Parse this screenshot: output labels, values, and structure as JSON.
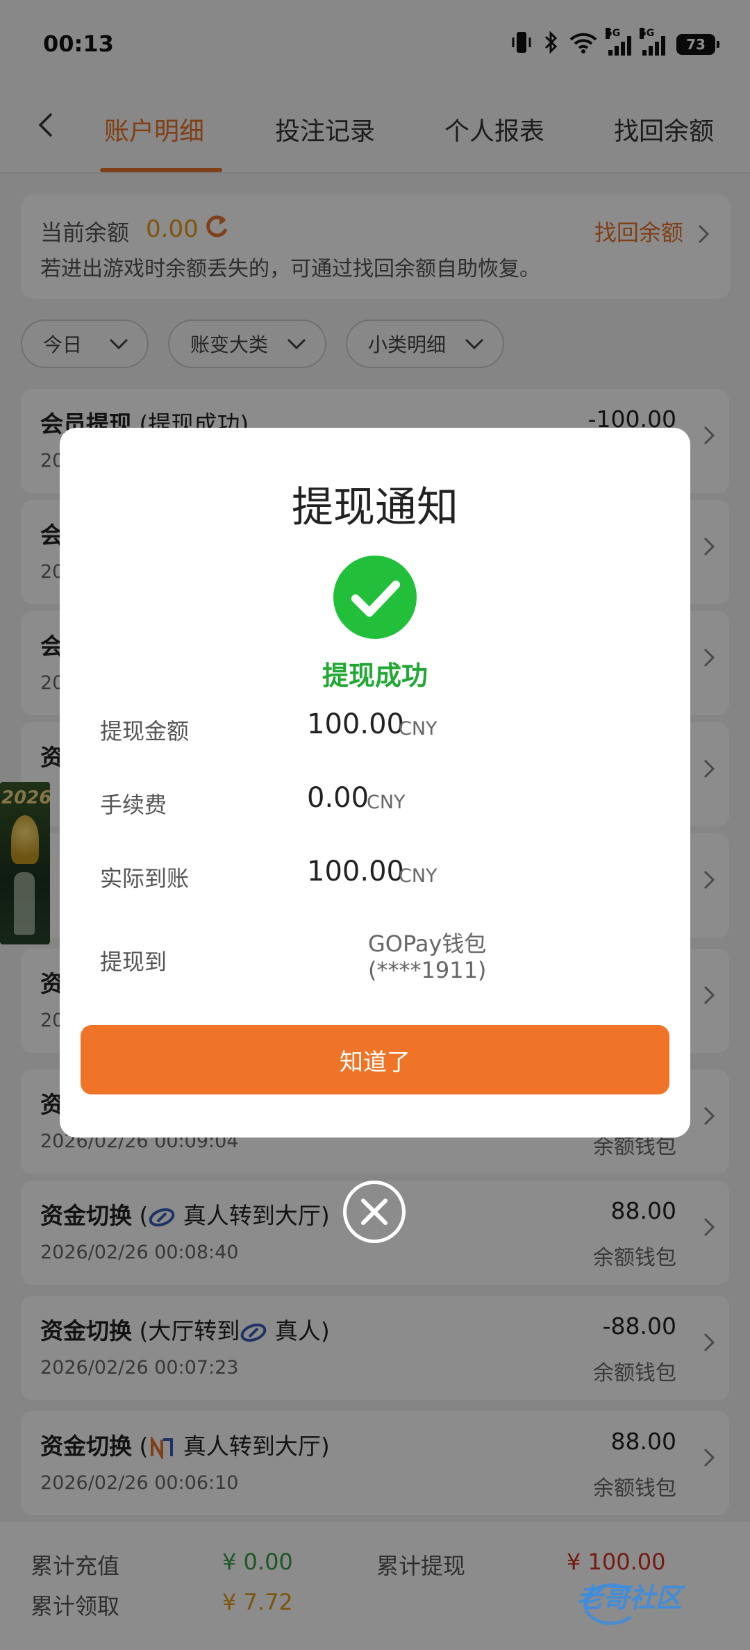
{
  "status_bar": {
    "time": "00:13",
    "battery": "73",
    "signal_tag": "5G"
  },
  "nav": {
    "back": "<",
    "tabs": [
      {
        "label": "账户明细",
        "active": true
      },
      {
        "label": "投注记录",
        "active": false
      },
      {
        "label": "个人报表",
        "active": false
      },
      {
        "label": "找回余额",
        "active": false
      }
    ]
  },
  "balance": {
    "label": "当前余额",
    "value": "0.00",
    "recover_link": "找回余额",
    "tip": "若进出游戏时余额丢失的，可通过找回余额自助恢复。"
  },
  "filters": [
    {
      "label": "今日"
    },
    {
      "label": "账变大类"
    },
    {
      "label": "小类明细"
    }
  ],
  "records": [
    {
      "title": "会员提现",
      "detail": " (提现成功)",
      "date": "20",
      "amount": "-100.00",
      "wallet": ""
    },
    {
      "title": "会",
      "detail": "",
      "date": "20",
      "amount": "",
      "wallet": ""
    },
    {
      "title": "会",
      "detail": "",
      "date": "20",
      "amount": "",
      "wallet": ""
    },
    {
      "title": "资",
      "detail": "",
      "date": "",
      "amount": "",
      "wallet": ""
    },
    {
      "title": "",
      "detail": "",
      "date": "",
      "amount": "",
      "wallet": ""
    },
    {
      "title": "资",
      "detail": "",
      "date": "20",
      "amount": "",
      "wallet": ""
    },
    {
      "title": "资",
      "detail": "",
      "date": "2026/02/26 00:09:04",
      "amount": "",
      "wallet": "余额钱包"
    },
    {
      "title": "资金切换",
      "detail_pre": " (",
      "detail_post": " 真人转到大厅)",
      "date": "2026/02/26 00:08:40",
      "amount": "88.00",
      "wallet": "余额钱包"
    },
    {
      "title": "资金切换",
      "detail_pre": " (大厅转到",
      "detail_post": " 真人)",
      "date": "2026/02/26 00:07:23",
      "amount": "-88.00",
      "wallet": "余额钱包"
    },
    {
      "title": "资金切换",
      "detail_pre": " (",
      "detail_post": " 真人转到大厅)",
      "date": "2026/02/26 00:06:10",
      "amount": "88.00",
      "wallet": "余额钱包"
    }
  ],
  "footer": {
    "recharge_label": "累计充值",
    "recharge_value": "¥ 0.00",
    "withdraw_label": "累计提现",
    "withdraw_value": "¥ 100.00",
    "claim_label": "累计领取",
    "claim_value": "¥ 7.72"
  },
  "promo": {
    "text": "2026"
  },
  "modal": {
    "title": "提现通知",
    "status": "提现成功",
    "rows": [
      {
        "label": "提现金额",
        "value": "100.00",
        "currency": "CNY"
      },
      {
        "label": "手续费",
        "value": "0.00",
        "currency": "CNY"
      },
      {
        "label": "实际到账",
        "value": "100.00",
        "currency": "CNY"
      }
    ],
    "dest_label": "提现到",
    "dest_line1": "GOPay钱包",
    "dest_line2": "(****1911)",
    "ok_button": "知道了"
  },
  "watermark": "老哥社区",
  "colors": {
    "accent": "#e8732a",
    "success": "#22c03a",
    "button": "#f07427",
    "overlay": "rgba(0,0,0,0.45)"
  }
}
